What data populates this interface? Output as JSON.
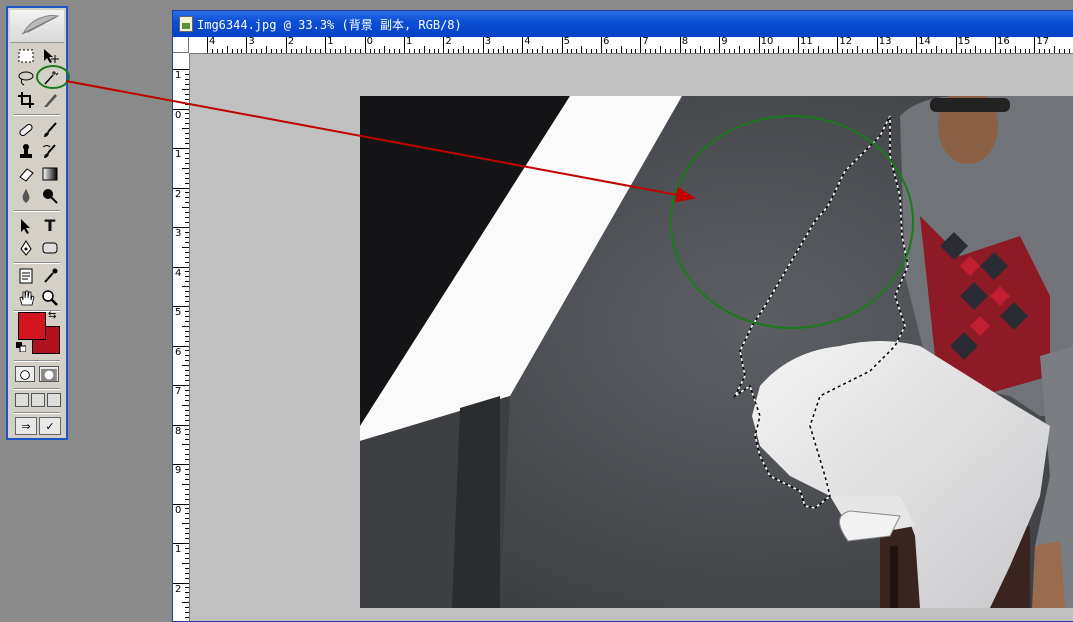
{
  "document": {
    "title": "Img6344.jpg @ 33.3% (背景 副本, RGB/8)"
  },
  "rulers": {
    "top_labels": [
      "4",
      "3",
      "2",
      "1",
      "0",
      "1",
      "2",
      "3",
      "4",
      "5",
      "6",
      "7",
      "8",
      "9",
      "10",
      "11",
      "12",
      "13",
      "14",
      "15",
      "16",
      "17"
    ],
    "left_labels": [
      "1",
      "0",
      "1",
      "2",
      "3",
      "4",
      "5",
      "6",
      "7",
      "8",
      "9",
      "0",
      "1",
      "2"
    ]
  },
  "colors": {
    "accent_title": "#0b4fd7",
    "foreground_color": "#d3151f",
    "background_color": "#b01221",
    "annotation_circle": "#1a7a1a",
    "annotation_arrow": "#c00000"
  },
  "toolbox": {
    "tools": [
      "rectangular-marquee-icon",
      "move-icon",
      "lasso-icon",
      "magic-wand-icon",
      "crop-icon",
      "slice-icon",
      "healing-brush-icon",
      "brush-icon",
      "clone-stamp-icon",
      "history-brush-icon",
      "eraser-icon",
      "gradient-icon",
      "blur-icon",
      "dodge-icon",
      "path-selection-icon",
      "type-icon",
      "pen-icon",
      "shape-icon",
      "notes-icon",
      "eyedropper-icon",
      "hand-icon",
      "zoom-icon"
    ]
  }
}
